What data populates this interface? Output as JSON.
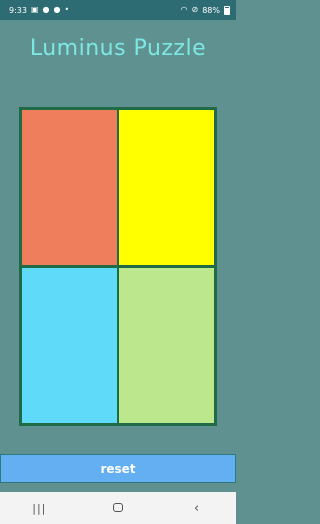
{
  "status_bar": {
    "time": "9:33",
    "battery": "88%",
    "left_icons": [
      "image-icon",
      "pin-icon",
      "pin-icon",
      "dot-icon"
    ],
    "right_icons": [
      "wifi-icon",
      "dnd-icon",
      "battery-icon"
    ]
  },
  "app": {
    "title": "Luminus Puzzle"
  },
  "board": {
    "tiles": [
      {
        "color": "#ee7e5c"
      },
      {
        "color": "#ffff00"
      },
      {
        "color": "#5fdaf8"
      },
      {
        "color": "#bde78d"
      }
    ]
  },
  "reset": {
    "label": "reset"
  },
  "nav": {
    "icons": [
      "recent-apps-icon",
      "home-icon",
      "back-icon"
    ]
  }
}
